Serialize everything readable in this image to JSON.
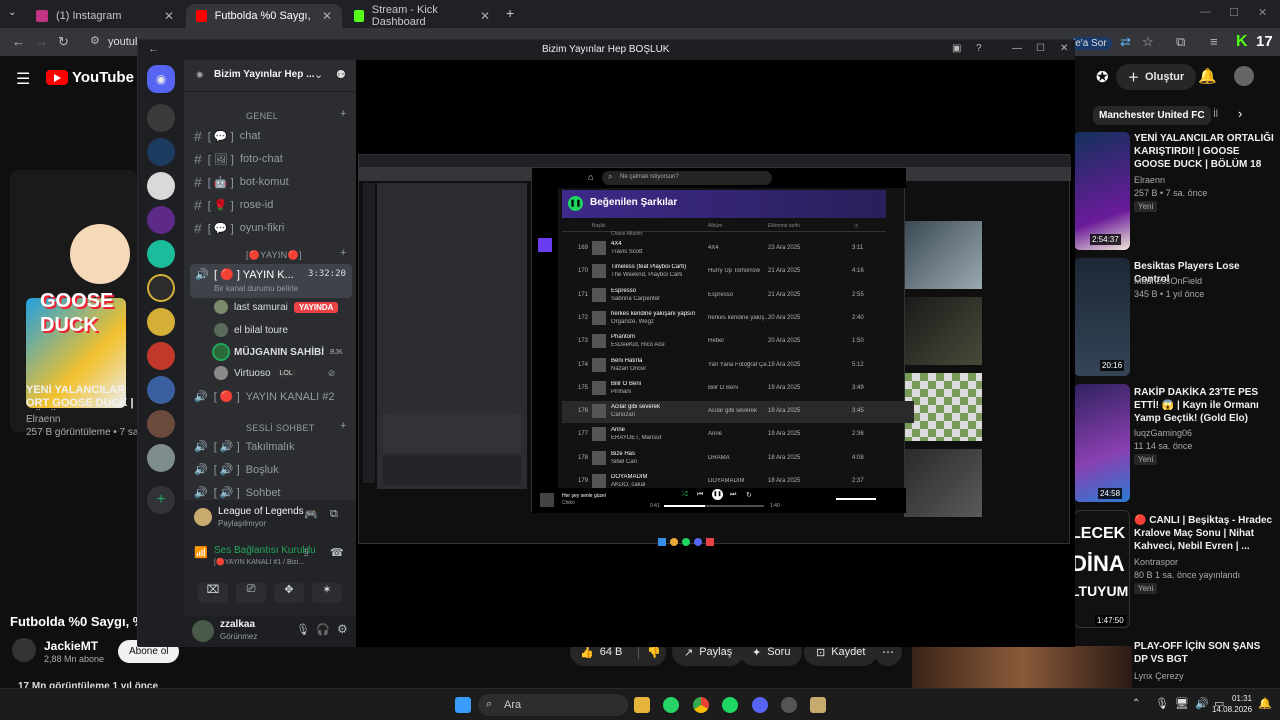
{
  "browser": {
    "tabs": [
      {
        "label": "(1) Instagram",
        "color": "#c13584",
        "active": false
      },
      {
        "label": "Futbolda %0 Saygı, %100 Spor",
        "color": "#ff0000",
        "active": true
      },
      {
        "label": "Stream - Kick Dashboard",
        "color": "#53fc18",
        "active": false
      }
    ],
    "new_tab_label": "+",
    "url_fragment": "youtub",
    "ask_label": "le'a Sor",
    "kick_counter": "17"
  },
  "youtube": {
    "logo_text": "YouTube",
    "region": "TR",
    "create_label": "Oluştur",
    "chip_label": "Manchester United FC",
    "chip_more": "İl",
    "left_video_title": "YENİ YALANCILAR ORT GOOSE DUCK | BÖLÜM",
    "left_channel": "Elraenn",
    "left_meta": "257 B görüntüleme • 7 sa",
    "thumb_goose": "GOOSE",
    "thumb_duck": "DUCK",
    "main_title": "Futbolda %0 Saygı, %",
    "channel_name": "JackieMT",
    "channel_subs": "2,88 Mn abone",
    "subscribe_label": "Abone ol",
    "likes": "64 B",
    "share_label": "Paylaş",
    "ask_label": "Soru",
    "save_label": "Kaydet",
    "views_line": "17 Mn görüntüleme  1 yıl önce",
    "recommendations": [
      {
        "title": "YENİ YALANCILAR ORTALIĞI KARIŞTIRDI! | GOOSE GOOSE DUCK | BÖLÜM 18",
        "channel": "Elraenn",
        "meta": "257 B • 7 sa. önce",
        "tag": "Yeni",
        "duration": "2:54:37",
        "color": "#1d4e89"
      },
      {
        "title": "Besiktas Players Lose Control",
        "channel": "MadnessOnField",
        "meta": "345 B • 1 yıl önce",
        "tag": "",
        "duration": "20:16",
        "color": "#202a36"
      },
      {
        "title": "RAKİP DAKİKA 23'TE PES ETTİ! 😱 | Kayn ile Ormanı Yamp Geçtik! (Gold Elo)",
        "channel": "luqzGaming06",
        "meta": "11  14 sa. önce",
        "tag": "Yeni",
        "duration": "24:58",
        "color": "#3b2a6a"
      },
      {
        "title": "🔴 CANLI | Beşiktaş - Hradec Kralove Maç Sonu | Nihat Kahveci, Nebil Evren | ...",
        "channel": "Kontraspor",
        "meta": "80 B  1 sa. önce yayınlandı",
        "tag": "Yeni",
        "duration": "1:47:50",
        "color": "#101010"
      },
      {
        "title": "PLAY-OFF İÇİN SON ŞANS DP VS BGT",
        "channel": "Lynx Çerezy",
        "meta": "7,1 B • 3 sa. önce",
        "tag": "",
        "duration": "",
        "color": "#5a3020"
      }
    ],
    "thumb_text_1": "LECEK",
    "thumb_text_2": "DİNA",
    "thumb_text_3": "LTUYUM\""
  },
  "discord": {
    "window_title": "Bizim Yayınlar Hep BOŞLUK",
    "server_name": "Bizim Yayınlar Hep ...",
    "categories": [
      "GENEL",
      "[🔴YAYIN🔴]",
      "SESLİ SOHBET"
    ],
    "text_channels": [
      "chat",
      "foto-chat",
      "bot-komut",
      "rose-id",
      "oyun-fikri"
    ],
    "voice_channel_live": "YAYIN K...",
    "voice_timer": "3:32:20",
    "voice_status": "Bir kanal durumu belirle",
    "voice_users": [
      {
        "name": "last samurai",
        "badge": "YAYINDA"
      },
      {
        "name": "el bilal toure",
        "badge": ""
      },
      {
        "name": "MÜJGANIN SAHİBİ",
        "badge": "BJK"
      },
      {
        "name": "Virtuoso",
        "badge": "LOL"
      }
    ],
    "voice_channels": [
      "YAYIN KANALI #2",
      "Takılmalık",
      "Boşluk",
      "Sohbet"
    ],
    "activity_game": "League of Legends",
    "activity_status": "Paylaşılmıyor",
    "connection_status": "Ses Bağlantısı Kuruldu",
    "connection_detail": "[🔴YAYIN KANALI #1 / Bizi...",
    "username": "zzalkaa",
    "user_status": "Görünmez"
  },
  "spotify": {
    "search_placeholder": "Ne çalmak istiyorsun?",
    "playlist_title": "Beğenilen Şarkılar",
    "col_title": "Başlık",
    "col_album": "Albüm",
    "col_date": "Eklenme tarihi",
    "top_artist": "Chase Atlantic",
    "songs": [
      {
        "n": "169",
        "title": "4X4",
        "artist": "Travis Scott",
        "album": "4X4",
        "date": "23 Ara 2025",
        "dur": "3:11"
      },
      {
        "n": "170",
        "title": "Timeless (feat Playboi Carti)",
        "artist": "The Weeknd, Playboi Carti",
        "album": "Hurry Up Tomorrow",
        "date": "21 Ara 2025",
        "dur": "4:16"
      },
      {
        "n": "171",
        "title": "Espresso",
        "artist": "Sabrina Carpenter",
        "album": "Espresso",
        "date": "21 Ara 2025",
        "dur": "2:55"
      },
      {
        "n": "172",
        "title": "herkes kendine yakışanı yapsın",
        "artist": "Organize, Wegz",
        "album": "herkes kendine yakış...",
        "date": "20 Ara 2025",
        "dur": "2:40"
      },
      {
        "n": "173",
        "title": "Phantom",
        "artist": "EsDeeKid, Rico Ace",
        "album": "Rebel",
        "date": "20 Ara 2025",
        "dur": "1:50"
      },
      {
        "n": "174",
        "title": "Beni Hatırla",
        "artist": "Nazan Öncel",
        "album": "Yan Yana Fotoğraf Çe...",
        "date": "19 Ara 2025",
        "dur": "5:12"
      },
      {
        "n": "175",
        "title": "Bilir O Beni",
        "artist": "Pinhani",
        "album": "Bilir O Beni",
        "date": "19 Ara 2025",
        "dur": "3:49"
      },
      {
        "n": "176",
        "title": "Acılar gibi severek",
        "artist": "Canozan",
        "album": "Acılar gibi severek",
        "date": "19 Ara 2025",
        "dur": "3:45"
      },
      {
        "n": "177",
        "title": "Anne",
        "artist": "ERAYDET, Mansur",
        "album": "Anne",
        "date": "19 Ara 2025",
        "dur": "2:36"
      },
      {
        "n": "178",
        "title": "Bize Has",
        "artist": "Sibel Can",
        "album": "DRAMA",
        "date": "18 Ara 2025",
        "dur": "4:08"
      },
      {
        "n": "179",
        "title": "DOYAMADIM",
        "artist": "AKDO, cakal",
        "album": "DOYAMADIM",
        "date": "18 Ara 2025",
        "dur": "2:37"
      },
      {
        "n": "180",
        "title": "yıldızlar şahit aşkıma",
        "artist": "Lvbel C5",
        "album": "yıldızlar şahit aşkıma",
        "date": "18 Ara 2025",
        "dur": "2:36"
      }
    ],
    "now_playing_title": "Her şey senle güzel",
    "now_playing_artist": "Chiko",
    "time_elapsed": "0:41",
    "time_total": "1:40"
  },
  "taskbar": {
    "search_label": "Ara",
    "time": "01:31",
    "date": "14.08.2026"
  }
}
